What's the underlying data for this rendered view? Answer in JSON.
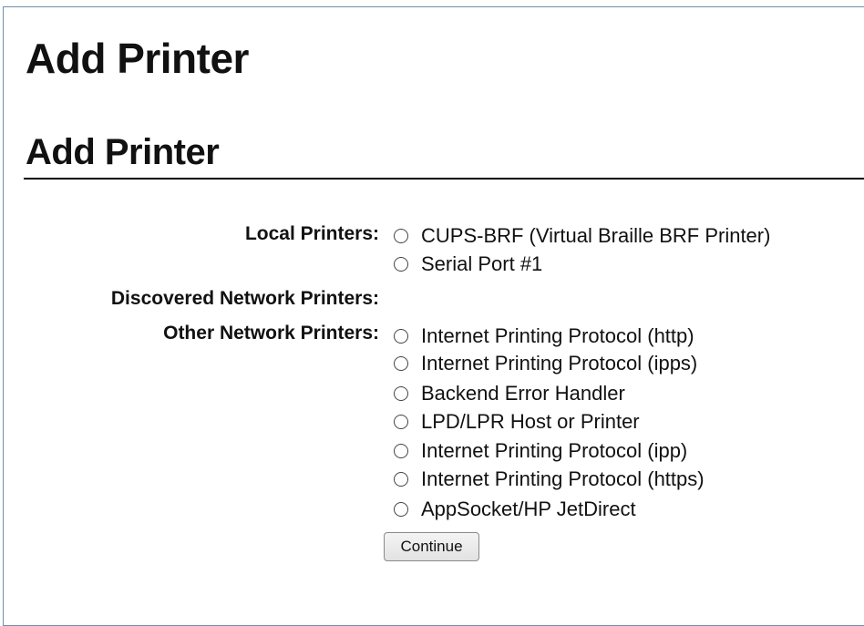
{
  "page": {
    "title": "Add Printer",
    "section_title": "Add Printer"
  },
  "local_printers": {
    "label": "Local Printers:",
    "options": [
      "CUPS-BRF (Virtual Braille BRF Printer)",
      "Serial Port #1"
    ]
  },
  "discovered_network_printers": {
    "label": "Discovered Network Printers:"
  },
  "other_network_printers": {
    "label": "Other Network Printers:",
    "options": [
      "Internet Printing Protocol (http)",
      "Internet Printing Protocol (ipps)",
      "Backend Error Handler",
      "LPD/LPR Host or Printer",
      "Internet Printing Protocol (ipp)",
      "Internet Printing Protocol (https)",
      "AppSocket/HP JetDirect"
    ]
  },
  "actions": {
    "continue_label": "Continue"
  },
  "icons": {
    "radio": "radio-button-unselected-icon"
  }
}
